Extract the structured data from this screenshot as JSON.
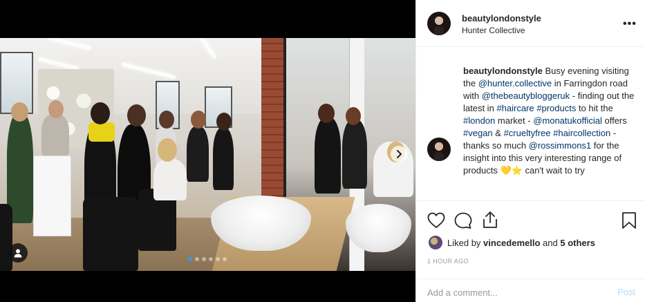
{
  "post": {
    "username": "beautylondonstyle",
    "location": "Hunter Collective"
  },
  "caption": {
    "username": "beautylondonstyle",
    "t1": " Busy evening visiting the ",
    "m1": "@hunter.collective",
    "t2": " in Farringdon road with ",
    "m2": "@thebeautybloggeruk",
    "t3": " - finding out the latest in ",
    "h1": "#haircare",
    "t4": " ",
    "h2": "#products",
    "t5": " to hit the ",
    "h3": "#london",
    "t6": " market - ",
    "m3": "@monatukofficial",
    "t7": " offers ",
    "h4": "#vegan",
    "t8": " & ",
    "h5": "#crueltyfree",
    "t9": " ",
    "h6": "#haircollection",
    "t10": " - thanks so much ",
    "m4": "@rossimmons1",
    "t11": " for the insight into this very interesting range of products 💛⭐",
    "t12": "can't wait to try"
  },
  "likes": {
    "prefix": "Liked by ",
    "user": "vincedemello",
    "joiner": " and ",
    "others": "5 others"
  },
  "timestamp": "1 HOUR AGO",
  "comment": {
    "placeholder": "Add a comment...",
    "post_label": "Post"
  },
  "carousel": {
    "total": 6,
    "active_index": 0
  },
  "icons": {
    "more": "more-options-icon",
    "like": "heart-icon",
    "comment": "comment-icon",
    "share": "share-icon",
    "save": "bookmark-icon",
    "next": "chevron-right-icon",
    "tag": "user-tag-icon"
  },
  "colors": {
    "link": "#003569",
    "carousel_active": "#3897f0",
    "post_disabled": "#b3dbff"
  }
}
